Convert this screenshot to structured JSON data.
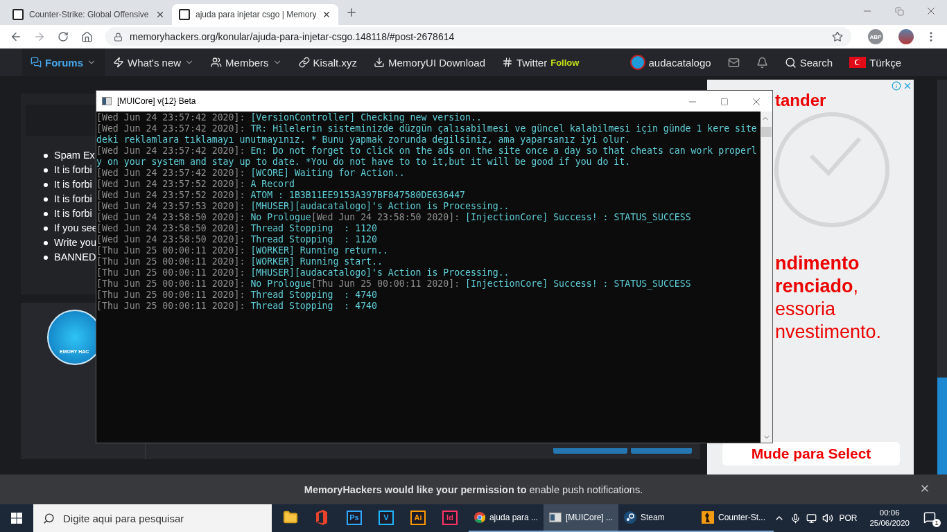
{
  "browser": {
    "tabs": [
      {
        "title": "Counter-Strike: Global Offensive",
        "selected": false
      },
      {
        "title": "ajuda para injetar csgo | Memory",
        "selected": true
      }
    ],
    "forward": {
      "disabled": true
    },
    "url": "memoryhackers.org/konular/ajuda-para-injetar-csgo.148118/#post-2678614",
    "extension": "ABP"
  },
  "nav": {
    "items": [
      {
        "label": "Forums",
        "selected": true,
        "dropdown": true
      },
      {
        "label": "What's new",
        "selected": false,
        "dropdown": true
      },
      {
        "label": "Members",
        "selected": false,
        "dropdown": true
      },
      {
        "label": "Kisalt.xyz",
        "selected": false,
        "dropdown": false
      },
      {
        "label": "MemoryUI Download",
        "selected": false,
        "dropdown": false
      },
      {
        "label": "Twitter",
        "selected": false,
        "dropdown": false,
        "badge": "Follow"
      }
    ],
    "user": "audacatalogo",
    "search": "Search",
    "language": "Türkçe"
  },
  "rules": [
    "Spam Ex",
    "It is forbi",
    "It is forbi",
    "It is forbi",
    "It is forbi",
    "If you see",
    "Write you",
    "BANNED"
  ],
  "post": {
    "logo_text": "EMORY HAC"
  },
  "ad": {
    "brand": "tander",
    "lines": [
      {
        "text": "ndimento",
        "strong": true
      },
      {
        "text": "**renciado**,",
        "strong": false
      },
      {
        "text": "essoria",
        "strong": false
      },
      {
        "text": "nvestimento.",
        "strong": false
      }
    ],
    "button": "Mude para Select"
  },
  "console": {
    "title": "[MUICore] v{12} Beta",
    "lines": [
      [
        {
          "kind": "time",
          "text": "[Wed Jun 24 23:57:42 2020]:"
        },
        {
          "kind": "text",
          "text": "[VersionController] Checking new version.."
        }
      ],
      [
        {
          "kind": "time",
          "text": "[Wed Jun 24 23:57:42 2020]:"
        },
        {
          "kind": "text",
          "text": "TR: Hilelerin sisteminizde düzgün çalısabilmesi ve güncel kalabilmesi için günde 1 kere site"
        }
      ],
      [
        {
          "kind": "text",
          "text": "deki reklamlara tıklamayı unutmayınız. * Bunu yapmak zorunda degilsiniz, ama yaparsanız iyi olur."
        }
      ],
      [
        {
          "kind": "time",
          "text": "[Wed Jun 24 23:57:42 2020]:"
        },
        {
          "kind": "text",
          "text": "En: Do not forget to click on the ads on the site once a day so that cheats can work properl"
        }
      ],
      [
        {
          "kind": "text",
          "text": "y on your system and stay up to date. *You do not have to to it,but it will be good if you do it."
        }
      ],
      [
        {
          "kind": "time",
          "text": "[Wed Jun 24 23:57:42 2020]:"
        },
        {
          "kind": "text",
          "text": "[WCORE] Waiting for Action.."
        }
      ],
      [
        {
          "kind": "time",
          "text": "[Wed Jun 24 23:57:52 2020]:"
        },
        {
          "kind": "text",
          "text": "A Record"
        }
      ],
      [
        {
          "kind": "time",
          "text": "[Wed Jun 24 23:57:52 2020]:"
        },
        {
          "kind": "text",
          "text": "ATOM : 1B3B11EE9153A397BF847580DE636447"
        }
      ],
      [
        {
          "kind": "time",
          "text": "[Wed Jun 24 23:57:53 2020]:"
        },
        {
          "kind": "text",
          "text": "[MHUSER][audacatalogo]'s Action is Processing.."
        }
      ],
      [
        {
          "kind": "time",
          "text": "[Wed Jun 24 23:58:50 2020]:"
        },
        {
          "kind": "prefix",
          "text": "No Prologue"
        },
        {
          "kind": "time",
          "text": "[Wed Jun 24 23:58:50 2020]:"
        },
        {
          "kind": "text",
          "text": "[InjectionCore] Success! : STATUS_SUCCESS"
        }
      ],
      [
        {
          "kind": "time",
          "text": "[Wed Jun 24 23:58:50 2020]:"
        },
        {
          "kind": "text",
          "text": "Thread Stopping  : 1120"
        }
      ],
      [
        {
          "kind": "time",
          "text": "[Wed Jun 24 23:58:50 2020]:"
        },
        {
          "kind": "text",
          "text": "Thread Stopping  : 1120"
        }
      ],
      [
        {
          "kind": "time",
          "text": "[Thu Jun 25 00:00:11 2020]:"
        },
        {
          "kind": "text",
          "text": "[WORKER] Running return.."
        }
      ],
      [
        {
          "kind": "time",
          "text": "[Thu Jun 25 00:00:11 2020]:"
        },
        {
          "kind": "text",
          "text": "[WORKER] Running start.."
        }
      ],
      [
        {
          "kind": "time",
          "text": "[Thu Jun 25 00:00:11 2020]:"
        },
        {
          "kind": "text",
          "text": "[MHUSER][audacatalogo]'s Action is Processing.."
        }
      ],
      [
        {
          "kind": "time",
          "text": "[Thu Jun 25 00:00:11 2020]:"
        },
        {
          "kind": "prefix",
          "text": "No Prologue"
        },
        {
          "kind": "time",
          "text": "[Thu Jun 25 00:00:11 2020]:"
        },
        {
          "kind": "text",
          "text": "[InjectionCore] Success! : STATUS_SUCCESS"
        }
      ],
      [
        {
          "kind": "time",
          "text": "[Thu Jun 25 00:00:11 2020]:"
        },
        {
          "kind": "text",
          "text": "Thread Stopping  : 4740"
        }
      ],
      [
        {
          "kind": "time",
          "text": "[Thu Jun 25 00:00:11 2020]:"
        },
        {
          "kind": "text",
          "text": "Thread Stopping  : 4740"
        }
      ]
    ]
  },
  "push": {
    "message": "**MemoryHackers would like your permission to** enable push notifications."
  },
  "taskbar": {
    "search_placeholder": "Digite aqui para pesquisar",
    "apps": [
      {
        "kind": "folder"
      },
      {
        "kind": "office"
      },
      {
        "kind": "letters",
        "text": "Ps",
        "color": "#31a8ff"
      },
      {
        "kind": "letters",
        "text": "V",
        "color": "#1fb6ff"
      },
      {
        "kind": "letters",
        "text": "Ai",
        "color": "#ff9a00"
      },
      {
        "kind": "letters",
        "text": "Id",
        "color": "#ff3366"
      },
      {
        "kind": "browser",
        "label": "ajuda para ...",
        "selected": false
      },
      {
        "kind": "console",
        "label": "[MUICore] ...",
        "selected": true
      },
      {
        "kind": "steam",
        "label": "Steam",
        "selected": false
      },
      {
        "kind": "game",
        "label": "Counter-St...",
        "selected": false
      }
    ],
    "language": "POR",
    "time": "00:06",
    "date": "25/06/2020",
    "notifications": "1"
  }
}
